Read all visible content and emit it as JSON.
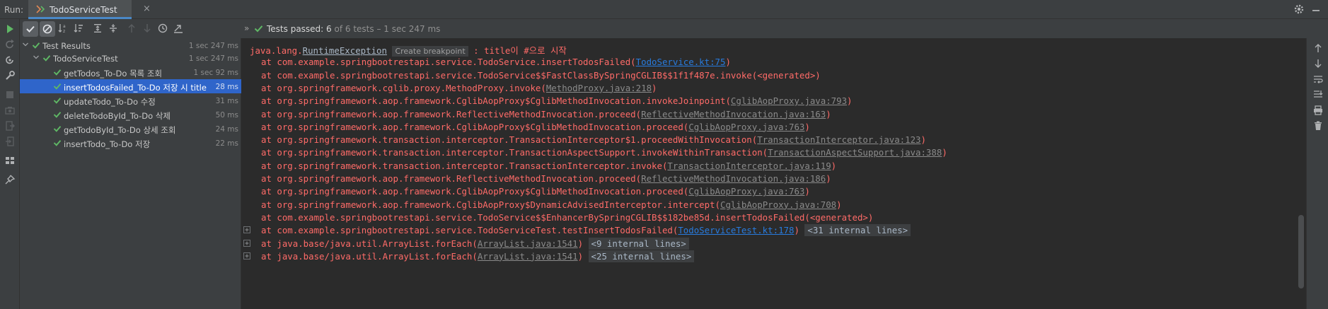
{
  "tabbar": {
    "run_label": "Run:",
    "tab_title": "TodoServiceTest",
    "close_glyph": "×"
  },
  "status": {
    "chevrons": "»",
    "label": "Tests passed:",
    "count": "6",
    "rest": "of 6 tests – 1 sec 247 ms"
  },
  "tree": {
    "items": [
      {
        "label": "Test Results",
        "time": "1 sec 247 ms"
      },
      {
        "label": "TodoServiceTest",
        "time": "1 sec 247 ms"
      },
      {
        "label": "getTodos_To-Do 목록 조회",
        "time": "1 sec 92 ms"
      },
      {
        "label": "insertTodosFailed_To-Do 저장 시 title",
        "time": "28 ms"
      },
      {
        "label": "updateTodo_To-Do 수정",
        "time": "31 ms"
      },
      {
        "label": "deleteTodoById_To-Do 삭제",
        "time": "50 ms"
      },
      {
        "label": "getTodoById_To-Do 상세 조회",
        "time": "24 ms"
      },
      {
        "label": "insertTodo_To-Do 저장",
        "time": "22 ms"
      }
    ]
  },
  "console": {
    "exception": {
      "prefix": "java.lang.",
      "class_link": "RuntimeException",
      "breakpoint": "Create breakpoint",
      "message": " : title이 #으로 시작"
    },
    "frames": [
      {
        "text": "at com.example.springbootrestapi.service.TodoService.insertTodosFailed(",
        "link": "TodoService.kt:75",
        "link_style": "blue",
        "suffix": ")",
        "badge": ""
      },
      {
        "text": "at com.example.springbootrestapi.service.TodoService$$FastClassBySpringCGLIB$$1f1f487e.invoke(<generated>)",
        "link": "",
        "link_style": "",
        "suffix": "",
        "badge": ""
      },
      {
        "text": "at org.springframework.cglib.proxy.MethodProxy.invoke(",
        "link": "MethodProxy.java:218",
        "link_style": "gray",
        "suffix": ")",
        "badge": ""
      },
      {
        "text": "at org.springframework.aop.framework.CglibAopProxy$CglibMethodInvocation.invokeJoinpoint(",
        "link": "CglibAopProxy.java:793",
        "link_style": "gray",
        "suffix": ")",
        "badge": ""
      },
      {
        "text": "at org.springframework.aop.framework.ReflectiveMethodInvocation.proceed(",
        "link": "ReflectiveMethodInvocation.java:163",
        "link_style": "gray",
        "suffix": ")",
        "badge": ""
      },
      {
        "text": "at org.springframework.aop.framework.CglibAopProxy$CglibMethodInvocation.proceed(",
        "link": "CglibAopProxy.java:763",
        "link_style": "gray",
        "suffix": ")",
        "badge": ""
      },
      {
        "text": "at org.springframework.transaction.interceptor.TransactionInterceptor$1.proceedWithInvocation(",
        "link": "TransactionInterceptor.java:123",
        "link_style": "gray",
        "suffix": ")",
        "badge": ""
      },
      {
        "text": "at org.springframework.transaction.interceptor.TransactionAspectSupport.invokeWithinTransaction(",
        "link": "TransactionAspectSupport.java:388",
        "link_style": "gray",
        "suffix": ")",
        "badge": ""
      },
      {
        "text": "at org.springframework.transaction.interceptor.TransactionInterceptor.invoke(",
        "link": "TransactionInterceptor.java:119",
        "link_style": "gray",
        "suffix": ")",
        "badge": ""
      },
      {
        "text": "at org.springframework.aop.framework.ReflectiveMethodInvocation.proceed(",
        "link": "ReflectiveMethodInvocation.java:186",
        "link_style": "gray",
        "suffix": ")",
        "badge": ""
      },
      {
        "text": "at org.springframework.aop.framework.CglibAopProxy$CglibMethodInvocation.proceed(",
        "link": "CglibAopProxy.java:763",
        "link_style": "gray",
        "suffix": ")",
        "badge": ""
      },
      {
        "text": "at org.springframework.aop.framework.CglibAopProxy$DynamicAdvisedInterceptor.intercept(",
        "link": "CglibAopProxy.java:708",
        "link_style": "gray",
        "suffix": ")",
        "badge": ""
      },
      {
        "text": "at com.example.springbootrestapi.service.TodoService$$EnhancerBySpringCGLIB$$182be85d.insertTodosFailed(<generated>)",
        "link": "",
        "link_style": "",
        "suffix": "",
        "badge": ""
      },
      {
        "text": "at com.example.springbootrestapi.service.TodoServiceTest.testInsertTodosFailed(",
        "link": "TodoServiceTest.kt:178",
        "link_style": "blue",
        "suffix": ")",
        "badge": "<31 internal lines>"
      },
      {
        "text": "at java.base/java.util.ArrayList.forEach(",
        "link": "ArrayList.java:1541",
        "link_style": "gray",
        "suffix": ")",
        "badge": "<9 internal lines>"
      },
      {
        "text": "at java.base/java.util.ArrayList.forEach(",
        "link": "ArrayList.java:1541",
        "link_style": "gray",
        "suffix": ")",
        "badge": "<25 internal lines>"
      }
    ]
  },
  "colors": {
    "error_text": "#ff6b68",
    "link_blue": "#287bde",
    "pass_green": "#5fb865",
    "selection": "#2f65ca"
  }
}
